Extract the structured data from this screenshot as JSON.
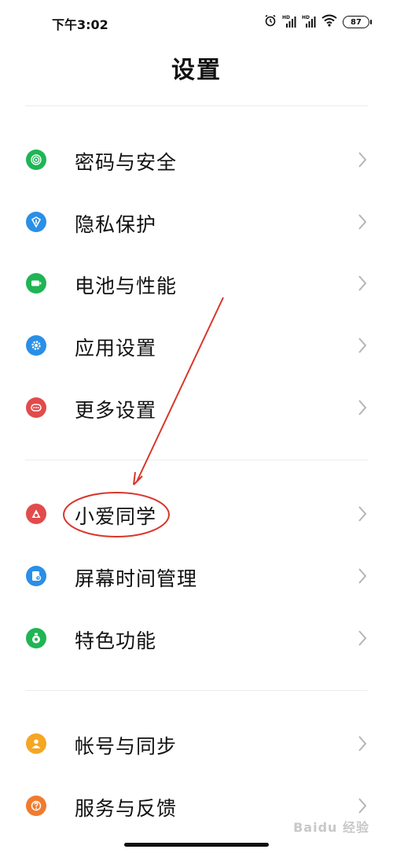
{
  "status_bar": {
    "time": "下午3:02",
    "battery_level": "87"
  },
  "page": {
    "title": "设置"
  },
  "groups": [
    {
      "items": [
        {
          "label": "密码与安全",
          "icon": "fingerprint-icon",
          "color": "#1fb554"
        },
        {
          "label": "隐私保护",
          "icon": "privacy-icon",
          "color": "#2a8fe6"
        },
        {
          "label": "电池与性能",
          "icon": "battery-icon",
          "color": "#1fb554"
        },
        {
          "label": "应用设置",
          "icon": "gear-icon",
          "color": "#2a8fe6"
        },
        {
          "label": "更多设置",
          "icon": "more-dots-icon",
          "color": "#e24b4b"
        }
      ]
    },
    {
      "items": [
        {
          "label": "小爱同学",
          "icon": "xiaoai-icon",
          "color": "#e24b4b"
        },
        {
          "label": "屏幕时间管理",
          "icon": "screen-time-icon",
          "color": "#2a8fe6"
        },
        {
          "label": "特色功能",
          "icon": "features-icon",
          "color": "#1fb554"
        }
      ]
    },
    {
      "items": [
        {
          "label": "帐号与同步",
          "icon": "account-icon",
          "color": "#f5a623"
        },
        {
          "label": "服务与反馈",
          "icon": "feedback-icon",
          "color": "#f07b2e"
        }
      ]
    }
  ],
  "annotation_color": "#d9362b",
  "watermark": "Baidu 经验"
}
